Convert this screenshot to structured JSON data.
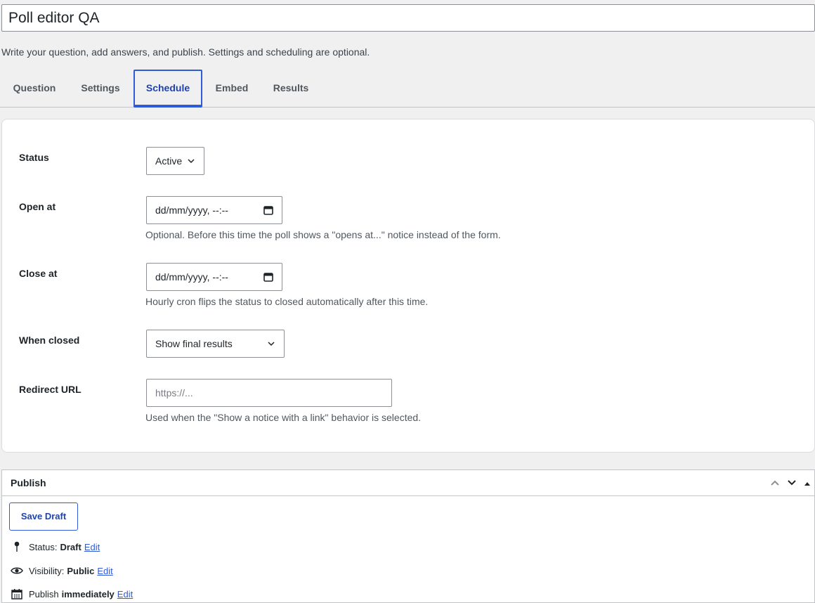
{
  "header": {
    "title": "Poll editor QA",
    "description": "Write your question, add answers, and publish. Settings and scheduling are optional."
  },
  "tabs": [
    {
      "label": "Question"
    },
    {
      "label": "Settings"
    },
    {
      "label": "Schedule",
      "active": true
    },
    {
      "label": "Embed"
    },
    {
      "label": "Results"
    }
  ],
  "schedule": {
    "status": {
      "label": "Status",
      "value": "Active"
    },
    "open_at": {
      "label": "Open at",
      "value": "dd/mm/yyyy, --:--",
      "hint": "Optional. Before this time the poll shows a \"opens at...\" notice instead of the form."
    },
    "close_at": {
      "label": "Close at",
      "value": "dd/mm/yyyy, --:--",
      "hint": "Hourly cron flips the status to closed automatically after this time."
    },
    "when_closed": {
      "label": "When closed",
      "value": "Show final results"
    },
    "redirect_url": {
      "label": "Redirect URL",
      "placeholder": "https://...",
      "hint": "Used when the \"Show a notice with a link\" behavior is selected."
    }
  },
  "publish": {
    "title": "Publish",
    "save_draft": "Save Draft",
    "status_label": "Status:",
    "status_value": "Draft",
    "visibility_label": "Visibility:",
    "visibility_value": "Public",
    "publish_label": "Publish",
    "publish_value": "immediately",
    "edit_label": "Edit"
  },
  "icons": {
    "status": "pin-icon",
    "visibility": "eye-icon",
    "publish": "calendar-icon"
  },
  "colors": {
    "accent": "#2f5bd6",
    "background": "#f0f0f1"
  }
}
